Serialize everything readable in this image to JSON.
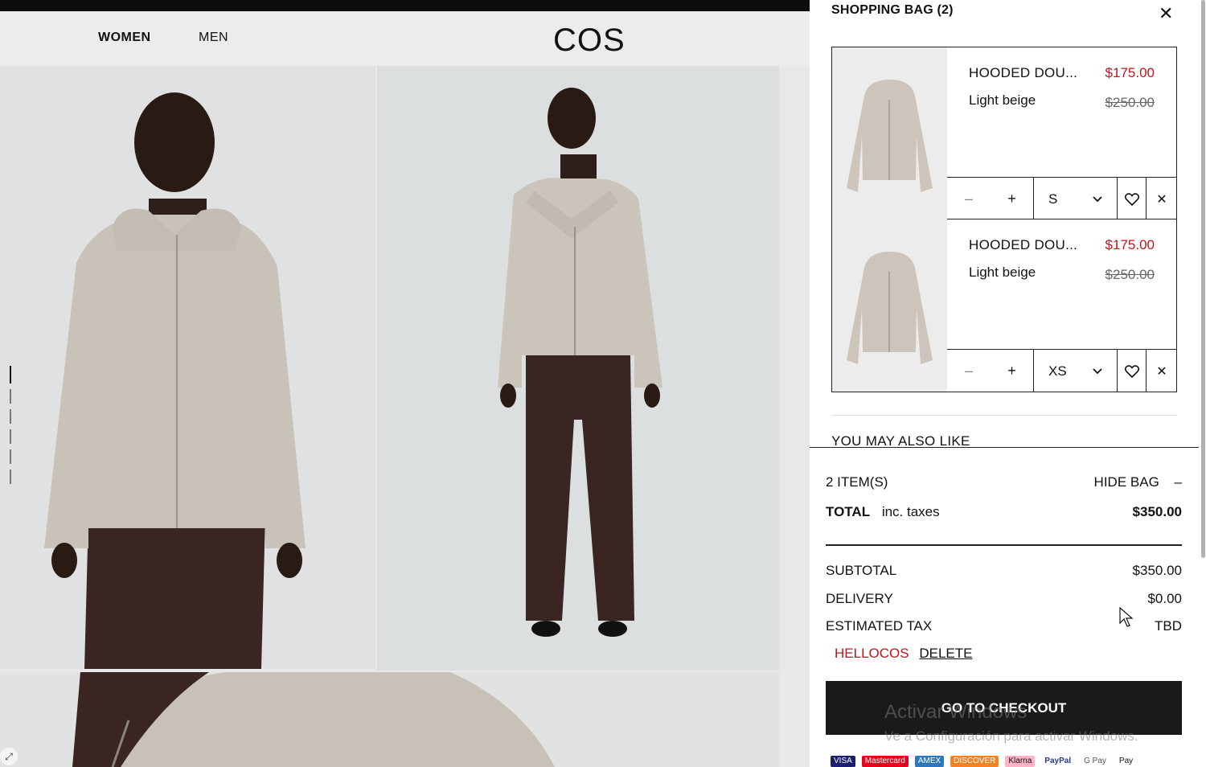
{
  "header": {
    "nav": [
      "WOMEN",
      "MEN"
    ],
    "logo": "COS"
  },
  "bag": {
    "title": "SHOPPING BAG (2)",
    "items": [
      {
        "name": "HOODED DOU...",
        "color": "Light beige",
        "price": "$175.00",
        "was_price": "$250.00",
        "size": "S"
      },
      {
        "name": "HOODED DOU...",
        "color": "Light beige",
        "price": "$175.00",
        "was_price": "$250.00",
        "size": "XS"
      }
    ],
    "also_like": "YOU MAY ALSO LIKE"
  },
  "summary": {
    "items_count": "2 ITEM(S)",
    "hide_bag": "HIDE BAG",
    "total_label": "TOTAL",
    "total_suffix": "inc. taxes",
    "total_value": "$350.00",
    "subtotal_label": "SUBTOTAL",
    "subtotal_value": "$350.00",
    "delivery_label": "DELIVERY",
    "delivery_value": "$0.00",
    "tax_label": "ESTIMATED TAX",
    "tax_value": "TBD",
    "promo_code": "HELLOCOS",
    "promo_delete": "DELETE",
    "checkout": "GO TO CHECKOUT",
    "payments": [
      "VISA",
      "Mastercard",
      "AMEX",
      "DISCOVER",
      "Klarna",
      "PayPal",
      "G Pay",
      "Pay"
    ]
  },
  "watermark": {
    "line1": "Activar Windows",
    "line2": "Ve a Configuración para activar Windows."
  },
  "colors": {
    "sale": "#c0141c",
    "checkout_bg": "#1a1a1a"
  }
}
